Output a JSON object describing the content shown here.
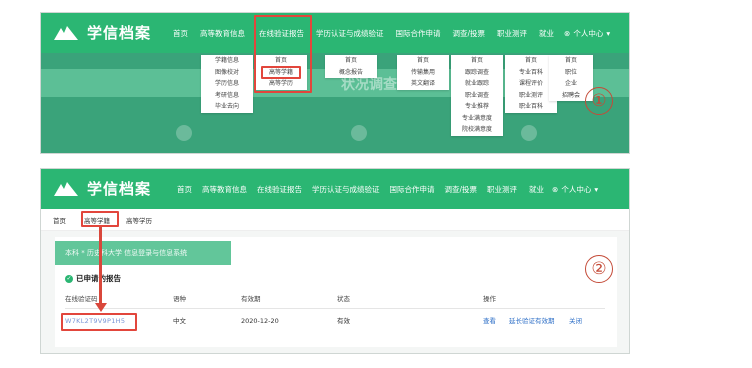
{
  "nav": {
    "logo_text": "学信档案",
    "items": [
      "首页",
      "高等教育信息",
      "在线验证报告",
      "学历认证与成绩验证",
      "国际合作申请",
      "调查/投票",
      "职业测评",
      "就业"
    ],
    "user": "个人中心"
  },
  "step_labels": [
    "①",
    "②"
  ],
  "hero_text": "状况调查",
  "dropdown": {
    "col1": [
      "学籍信息",
      "图像校对",
      "学历信息",
      "考研信息",
      "毕业去向"
    ],
    "col2": [
      "首页",
      "高等学籍",
      "高等学历"
    ],
    "col3": [
      "首页",
      "概念报告"
    ],
    "col4": [
      "首页",
      "传输集用",
      "英文翻译"
    ],
    "col5": [
      "首页",
      "跟踪调查",
      "就业跟踪",
      "职业调查",
      "专业推荐",
      "专业满意度",
      "院校满意度"
    ],
    "col6": [
      "首页",
      "专业百科",
      "课程评价",
      "职业测评",
      "职业百科"
    ],
    "col7": [
      "首页",
      "职位",
      "企业",
      "招聘会"
    ]
  },
  "subtabs": [
    "首页",
    "高等学籍",
    "高等学历"
  ],
  "banner_text": "本科 * 历史科大学 信息登录与信息系统",
  "section_title": "已申请的报告",
  "table": {
    "headers": [
      "在线验证码",
      "语种",
      "有效期",
      "状态",
      "操作"
    ],
    "row": {
      "code": "W7KL2T9V9P1H5",
      "language": "中文",
      "expiry": "2020-12-20",
      "status": "有效",
      "actions": [
        "查看",
        "延长验证有效期",
        "关闭"
      ]
    }
  },
  "colors": {
    "brand_green": "#2bb673",
    "highlight_red": "#e2463c",
    "link_blue": "#2e6fc7"
  }
}
